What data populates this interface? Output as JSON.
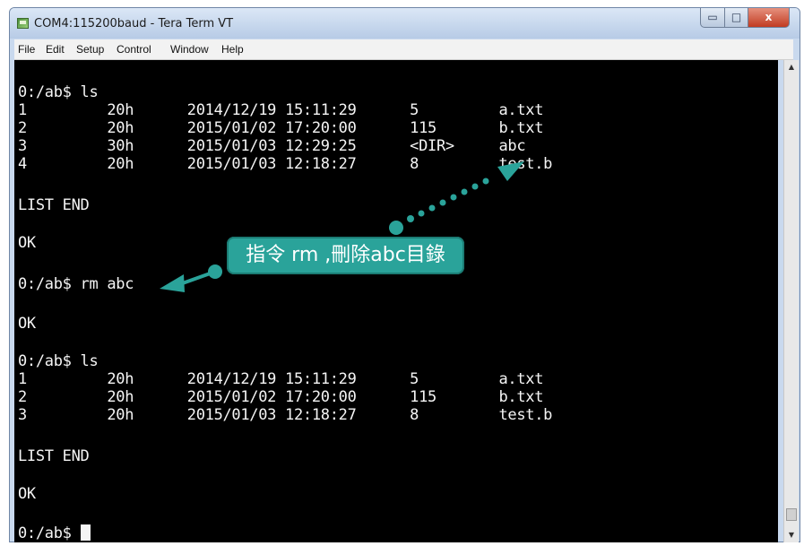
{
  "window": {
    "title": "COM4:115200baud - Tera Term VT",
    "controls": {
      "minimize": "▭",
      "maximize": "□",
      "close": "x"
    }
  },
  "menu": [
    "File",
    "Edit",
    "Setup",
    "Control",
    "Window",
    "Help"
  ],
  "terminal": {
    "lines": [
      "0:/ab$ ls",
      "1         20h      2014/12/19 15:11:29      5         a.txt",
      "2         20h      2015/01/02 17:20:00      115       b.txt",
      "3         30h      2015/01/03 12:29:25      <DIR>     abc",
      "4         20h      2015/01/03 12:18:27      8         test.b",
      "LIST END",
      "OK",
      "0:/ab$ rm abc",
      "OK",
      "0:/ab$ ls",
      "1         20h      2014/12/19 15:11:29      5         a.txt",
      "2         20h      2015/01/02 17:20:00      115       b.txt",
      "3         20h      2015/01/03 12:18:27      8         test.b",
      "LIST END",
      "OK",
      "0:/ab$ "
    ]
  },
  "annotation": {
    "text": "指令 rm ,刪除abc目錄",
    "color": "#2aa39a"
  },
  "scrollbar": {
    "up_icon": "▲",
    "down_icon": "▼"
  }
}
